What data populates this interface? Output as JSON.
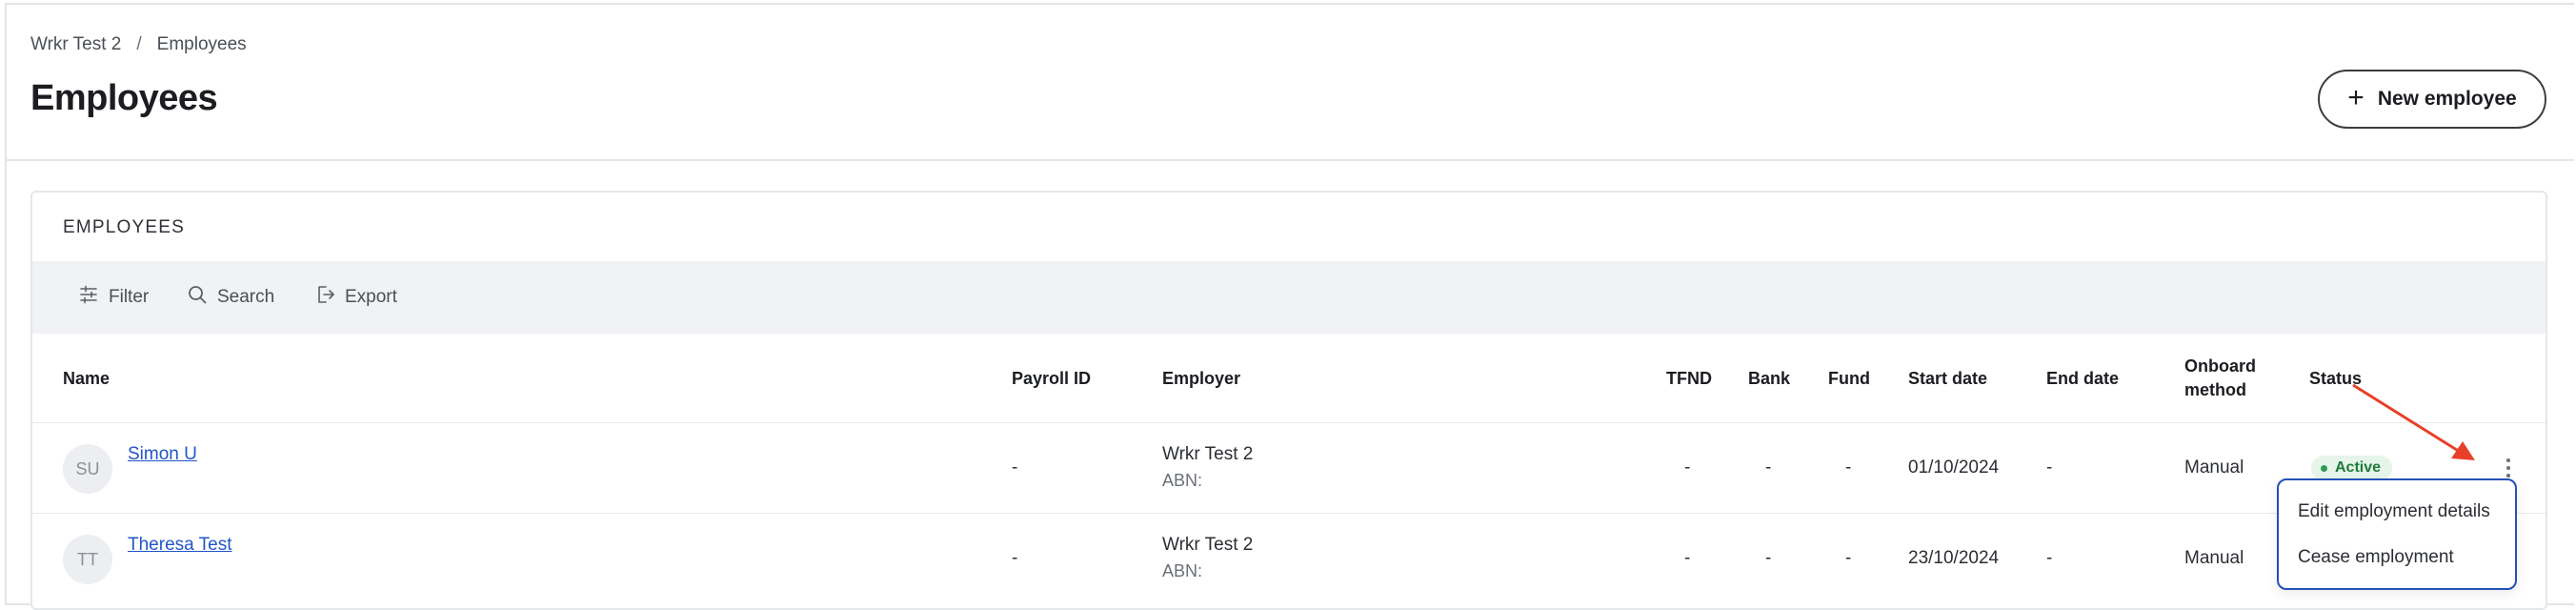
{
  "breadcrumb": {
    "parent": "Wrkr Test 2",
    "separator": "/",
    "current": "Employees"
  },
  "page": {
    "title": "Employees",
    "new_button_label": "New employee"
  },
  "card": {
    "title": "EMPLOYEES"
  },
  "toolbar": {
    "filter": "Filter",
    "search": "Search",
    "export": "Export"
  },
  "table": {
    "headers": {
      "name": "Name",
      "payroll_id": "Payroll ID",
      "employer": "Employer",
      "tfnd": "TFND",
      "bank": "Bank",
      "fund": "Fund",
      "start_date": "Start date",
      "end_date": "End date",
      "onboard_line1": "Onboard",
      "onboard_line2": "method",
      "status": "Status"
    },
    "rows": [
      {
        "initials": "SU",
        "name": "Simon U",
        "payroll_id": "-",
        "employer": "Wrkr Test 2",
        "abn": "ABN:",
        "tfnd": "-",
        "bank": "-",
        "fund": "-",
        "start_date": "01/10/2024",
        "end_date": "-",
        "onboard": "Manual",
        "status": "Active"
      },
      {
        "initials": "TT",
        "name": "Theresa Test",
        "payroll_id": "-",
        "employer": "Wrkr Test 2",
        "abn": "ABN:",
        "tfnd": "-",
        "bank": "-",
        "fund": "-",
        "start_date": "23/10/2024",
        "end_date": "-",
        "onboard": "Manual",
        "status": ""
      }
    ]
  },
  "row_menu": {
    "items": [
      "Edit employment details",
      "Cease employment"
    ]
  },
  "colors": {
    "accent_border": "#2451b8",
    "link": "#2256c7",
    "active_badge_bg": "#e5f5ea",
    "active_badge_text": "#1f7a3a",
    "annotation_arrow": "#e8402a"
  },
  "icons": {
    "filter": "sliders-icon",
    "search": "search-icon",
    "export": "export-icon",
    "new": "plus-icon",
    "row_actions": "kebab-icon"
  }
}
